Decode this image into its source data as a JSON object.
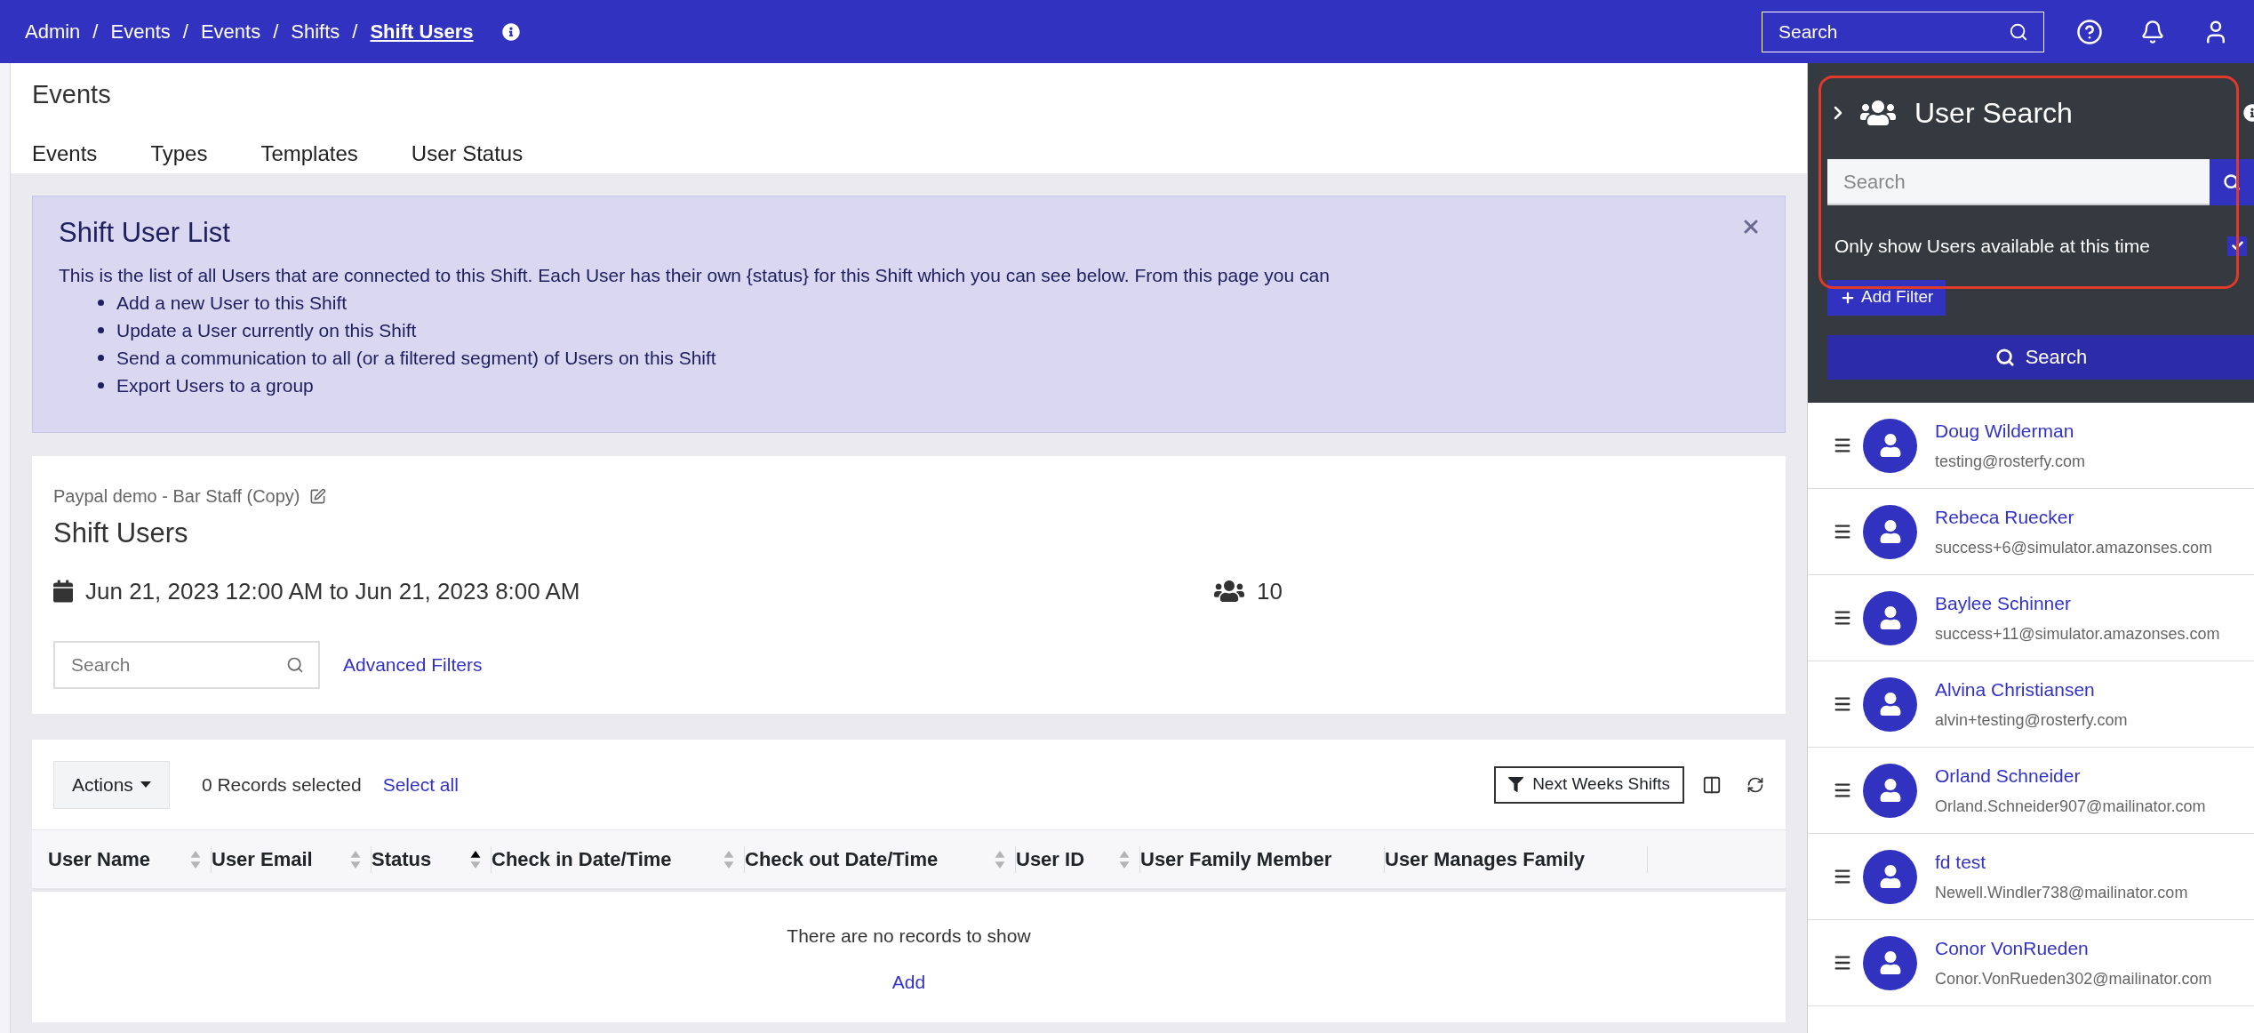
{
  "breadcrumbs": [
    {
      "label": "Admin",
      "current": false
    },
    {
      "separator": "/",
      "label": "Events",
      "current": false
    },
    {
      "separator": "/",
      "label": "Events",
      "current": false
    },
    {
      "separator": "/",
      "label": "Shifts",
      "current": false
    },
    {
      "separator": "/",
      "label": "Shift Users",
      "current": true
    }
  ],
  "top_search": {
    "placeholder": "Search"
  },
  "page": {
    "title": "Events",
    "tabs": [
      {
        "label": "Events",
        "selected": false
      },
      {
        "label": "Types",
        "selected": false
      },
      {
        "label": "Templates",
        "selected": false
      },
      {
        "label": "User Status",
        "selected": false
      }
    ]
  },
  "banner": {
    "title": "Shift User List",
    "intro": "This is the list of all Users that are connected to this Shift. Each User has their own {status} for this Shift which you can see below. From this page you can",
    "bullets": [
      "Add a new User to this Shift",
      "Update a User currently on this Shift",
      "Send a communication to all (or a filtered segment) of Users on this Shift",
      "Export Users to a group"
    ]
  },
  "shift": {
    "parent": "Paypal demo - Bar Staff (Copy)",
    "title": "Shift Users",
    "date_range": "Jun 21, 2023 12:00 AM to Jun 21, 2023 8:00 AM",
    "user_count": "10",
    "search": {
      "placeholder": "Search"
    },
    "advanced_filters": "Advanced Filters"
  },
  "table": {
    "actions": "Actions",
    "records_selected": "0 Records selected",
    "select_all": "Select all",
    "filter_button": "Next Weeks Shifts",
    "columns": [
      {
        "label": "User Name",
        "sortable": true,
        "sorted_ascending": false
      },
      {
        "label": "User Email",
        "sortable": true,
        "sorted_ascending": false
      },
      {
        "label": "Status",
        "sortable": true,
        "sorted_ascending": true
      },
      {
        "label": "Check in Date/Time",
        "sortable": true,
        "sorted_ascending": false
      },
      {
        "label": "Check out Date/Time",
        "sortable": true,
        "sorted_ascending": false
      },
      {
        "label": "User ID",
        "sortable": true,
        "sorted_ascending": false
      },
      {
        "label": "User Family Member",
        "sortable": false
      },
      {
        "label": "User Manages Family",
        "sortable": false
      }
    ],
    "empty_text": "There are no records to show",
    "add_link": "Add"
  },
  "user_search": {
    "title": "User Search",
    "search": {
      "placeholder": "Search"
    },
    "only_available": {
      "label": "Only show Users available at this time",
      "checked": true
    },
    "add_filter": "Add Filter",
    "search_button": "Search",
    "users": [
      {
        "name": "Doug Wilderman",
        "email": "testing@rosterfy.com"
      },
      {
        "name": "Rebeca Ruecker",
        "email": "success+6@simulator.amazonses.com"
      },
      {
        "name": "Baylee Schinner",
        "email": "success+11@simulator.amazonses.com"
      },
      {
        "name": "Alvina Christiansen",
        "email": "alvin+testing@rosterfy.com"
      },
      {
        "name": "Orland Schneider",
        "email": "Orland.Schneider907@mailinator.com"
      },
      {
        "name": "fd test",
        "email": "Newell.Windler738@mailinator.com"
      },
      {
        "name": "Conor VonRueden",
        "email": "Conor.VonRueden302@mailinator.com"
      }
    ]
  }
}
